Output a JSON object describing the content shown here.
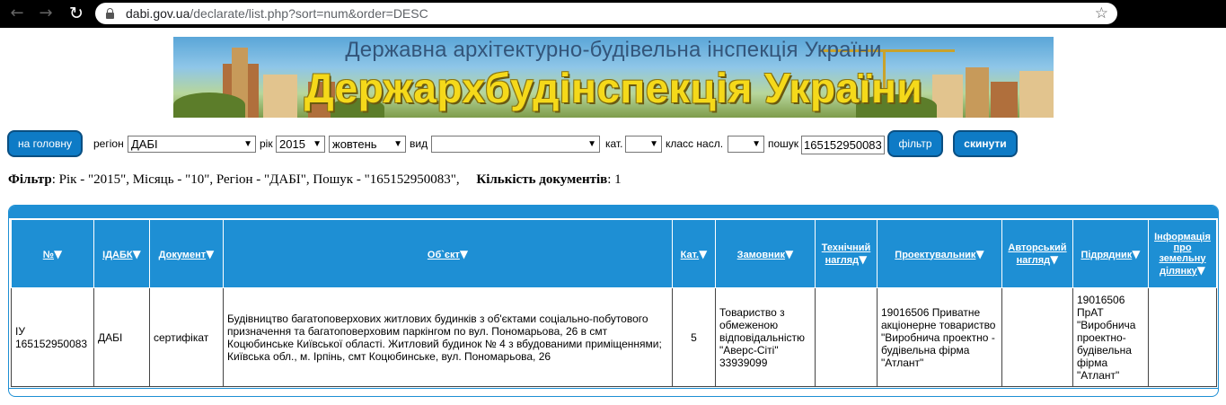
{
  "browser": {
    "url_host": "dabi.gov.ua",
    "url_rest": "/declarate/list.php?sort=num&order=DESC"
  },
  "banner": {
    "subtitle": "Державна архітектурно-будівельна інспекція України",
    "title": "Держархбудінспекція України"
  },
  "filters": {
    "home_button": "на головну",
    "region_label": "регіон",
    "region_value": "ДАБІ",
    "year_label": "рік",
    "year_value": "2015",
    "month_value": "жовтень",
    "kind_label": "вид",
    "kind_value": "",
    "category_label": "кат.",
    "category_value": "",
    "class_label": "класс насл.",
    "class_value": "",
    "search_label": "пошук",
    "search_value": "165152950083",
    "filter_button": "фільтр",
    "reset_button": "скинути"
  },
  "summary": {
    "filter_label": "Фільтр",
    "filter_text": ": Рік - \"2015\", Місяць - \"10\", Регіон - \"ДАБІ\", Пошук - \"165152950083\",",
    "count_label": "Кількість документів",
    "count_text": ": 1"
  },
  "table": {
    "columns": [
      "№",
      "ІДАБК",
      "Документ",
      "Об`єкт",
      "Кат.",
      "Замовник",
      "Технічний нагляд",
      "Проектувальник",
      "Авторський нагляд",
      "Підрядник",
      "Інформація про земельну ділянку"
    ],
    "rows": [
      [
        "ІУ 165152950083",
        "ДАБІ",
        "сертифікат",
        "Будівництво багатоповерхових житлових будинків з об'єктами соціально-побутового призначення та багатоповерховим паркінгом по вул. Пономарьова, 26 в смт Коцюбинське Київської області. Житловий будинок № 4 з вбудованими приміщеннями; Київська обл., м. Ірпінь, смт Коцюбинське, вул. Пономарьова, 26",
        "5",
        "Товариство з обмеженою відповідальністю \"Аверс-Сіті\" 33939099",
        "",
        "19016506 Приватне акціонерне товариство \"Виробнича проектно - будівельна фірма \"Атлант\"",
        "",
        "19016506 ПрАТ \"Виробнича проектно-будівельна фірма \"Атлант\"",
        ""
      ]
    ]
  }
}
